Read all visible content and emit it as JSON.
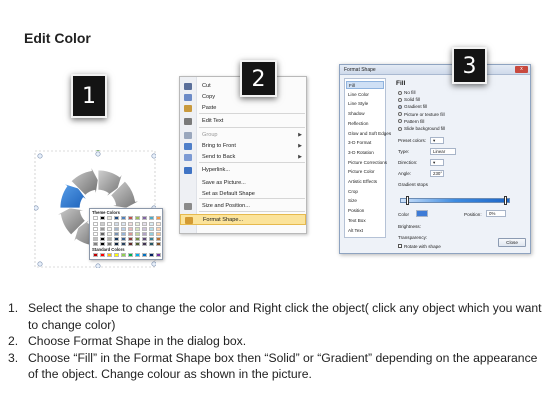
{
  "title": "Edit Color",
  "badges": [
    "1",
    "2",
    "3"
  ],
  "context_menu": {
    "items": [
      {
        "label": "Cut",
        "icon": "scissors-icon",
        "enabled": true
      },
      {
        "label": "Copy",
        "icon": "copy-icon",
        "enabled": true
      },
      {
        "label": "Paste",
        "icon": "paste-icon",
        "enabled": true
      },
      {
        "label": "Edit Text",
        "icon": "edit-text-icon",
        "enabled": true
      },
      {
        "label": "Group",
        "icon": "group-icon",
        "enabled": false,
        "submenu": true
      },
      {
        "label": "Bring to Front",
        "icon": "bring-to-front-icon",
        "enabled": true,
        "submenu": true
      },
      {
        "label": "Send to Back",
        "icon": "send-to-back-icon",
        "enabled": true,
        "submenu": true
      },
      {
        "label": "Hyperlink...",
        "icon": "hyperlink-icon",
        "enabled": true
      },
      {
        "label": "Save as Picture...",
        "icon": "",
        "enabled": true
      },
      {
        "label": "Set as Default Shape",
        "icon": "",
        "enabled": true
      },
      {
        "label": "Size and Position...",
        "icon": "size-icon",
        "enabled": true
      },
      {
        "label": "Format Shape...",
        "icon": "format-shape-icon",
        "enabled": true,
        "highlighted": true
      }
    ]
  },
  "format_shape": {
    "title": "Format Shape",
    "close_x": "x",
    "categories": [
      "Fill",
      "Line Color",
      "Line Style",
      "Shadow",
      "Reflection",
      "Glow and Soft Edges",
      "3-D Format",
      "3-D Rotation",
      "Picture Corrections",
      "Picture Color",
      "Artistic Effects",
      "Crop",
      "Size",
      "Position",
      "Text Box",
      "Alt Text"
    ],
    "selected_category": "Fill",
    "fill_heading": "Fill",
    "fill_options": [
      "No fill",
      "Solid fill",
      "Gradient fill",
      "Picture or texture fill",
      "Pattern fill",
      "Slide background fill"
    ],
    "selected_fill": "Gradient fill",
    "fields": {
      "preset_colors": "Preset colors:",
      "type_label": "Type:",
      "type_value": "Linear",
      "direction_label": "Direction:",
      "angle_label": "Angle:",
      "angle_value": "230°",
      "gradient_stops": "Gradient stops",
      "color_label": "Color",
      "position_label": "Position:",
      "position_value": "0%",
      "brightness_label": "Brightness:",
      "transparency_label": "Transparency:",
      "rotate_label": "Rotate with shape"
    },
    "palette": {
      "theme_label": "Theme Colors",
      "standard_label": "Standard Colors",
      "theme_top": [
        "#ffffff",
        "#000000",
        "#eeece1",
        "#1f497d",
        "#4f81bd",
        "#c0504d",
        "#9bbb59",
        "#8064a2",
        "#4bacc6",
        "#f79646"
      ],
      "standard": [
        "#c00000",
        "#ff0000",
        "#ffc000",
        "#ffff00",
        "#92d050",
        "#00b050",
        "#00b0f0",
        "#0070c0",
        "#002060",
        "#7030a0"
      ]
    },
    "close_button": "Close"
  },
  "instructions": [
    {
      "num": "1.",
      "text": "Select the shape to change the color and Right click the object( click any object which you want to change color)"
    },
    {
      "num": "2.",
      "text": "Choose Format Shape in the dialog box."
    },
    {
      "num": "3.",
      "text": "Choose “Fill” in the Format Shape box then “Solid” or “Gradient” depending on the appearance of the object. Change colour as shown in the picture."
    }
  ]
}
